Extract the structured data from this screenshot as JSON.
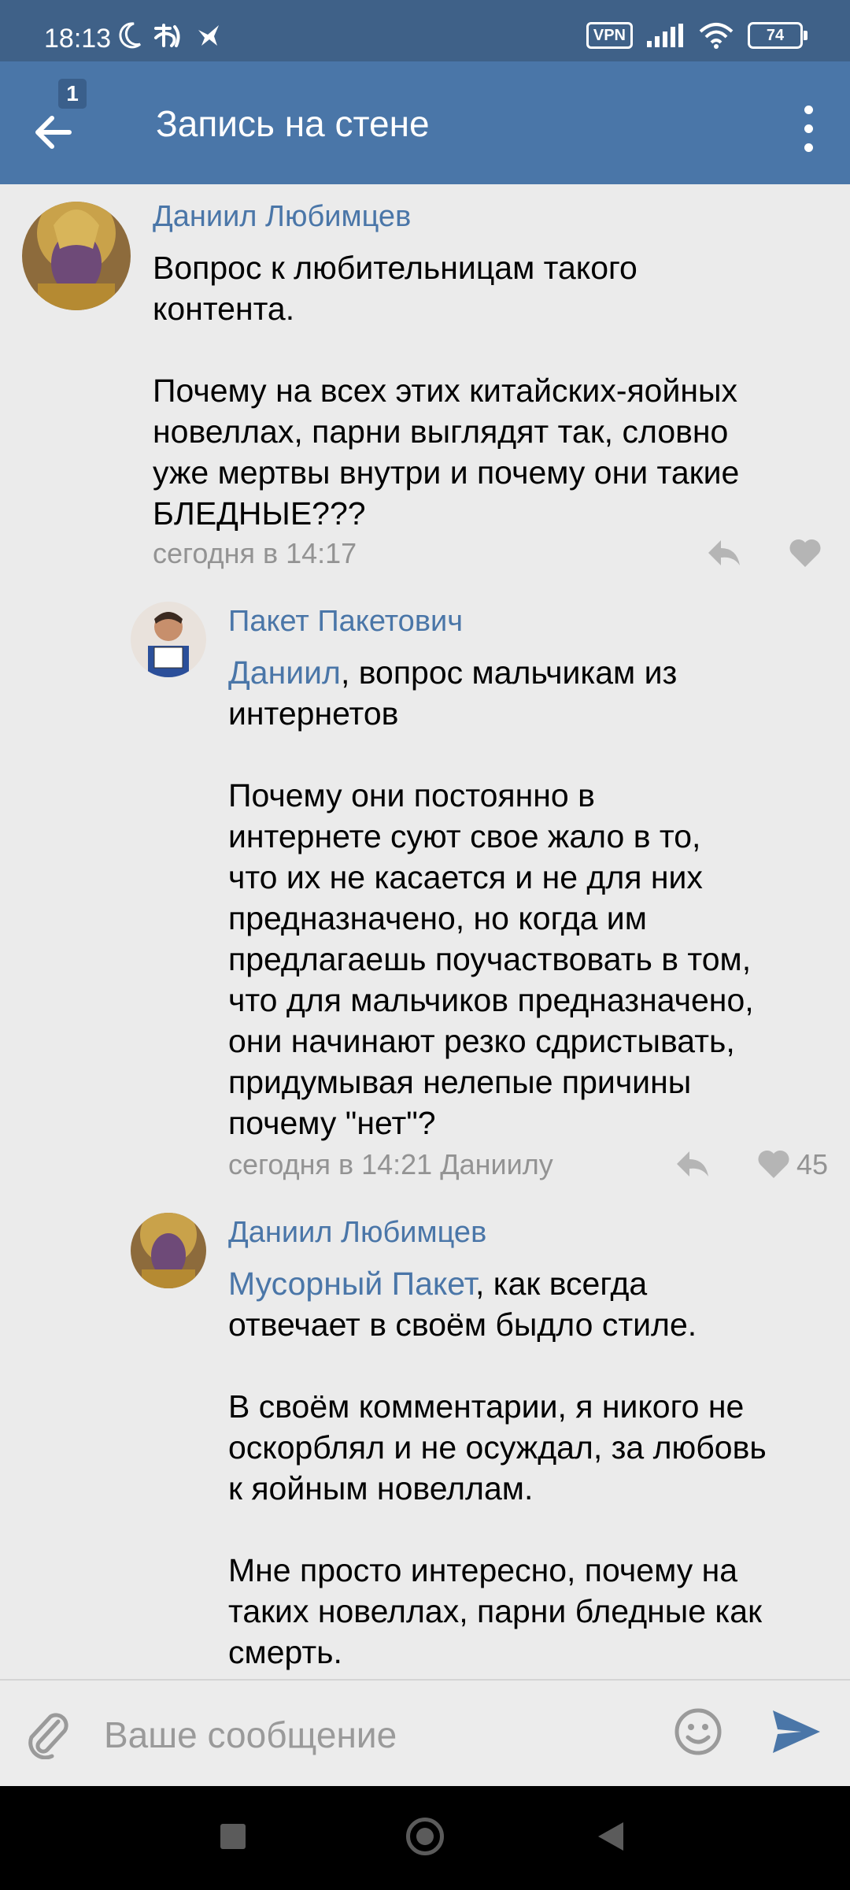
{
  "status_bar": {
    "time": "18:13",
    "vpn_label": "VPN",
    "battery": "74"
  },
  "header": {
    "back_badge": "1",
    "title": "Запись на стене"
  },
  "comments": [
    {
      "author": "Даниил Любимцев",
      "text": "Вопрос к любительницам такого\nконтента.\n\nПочему на всех этих китайских-яойных\nновеллах, парни выглядят так, словно\nуже мертвы внутри и почему они такие\nБЛЕДНЫЕ???",
      "meta": "сегодня в 14:17"
    },
    {
      "author": "Пакет Пакетович",
      "mention": "Даниил",
      "text": ", вопрос мальчикам из\nинтернетов\n\nПочему они постоянно в\nинтернете суют свое жало в то,\nчто их не касается и не для них\nпредназначено, но когда им\nпредлагаешь поучаствовать в том,\nчто для мальчиков предназначено,\nони начинают резко сдристывать,\nпридумывая нелепые причины\nпочему \"нет\"?",
      "meta": "сегодня в 14:21 Даниилу",
      "likes": "45"
    },
    {
      "author": "Даниил Любимцев",
      "mention": "Мусорный Пакет",
      "text": ", как всегда\nотвечает в своём быдло стиле.\n\nВ своём комментарии, я никого не\nоскорблял и не осуждал, за любовь\nк яойным новеллам.\n\nМне просто интересно, почему на\nтаких новеллах, парни бледные как\nсмерть."
    }
  ],
  "composer": {
    "placeholder": "Ваше сообщение"
  },
  "colors": {
    "header": "#4a76a8",
    "status_bar": "#3f6188",
    "link": "#4a76a8",
    "meta": "#939393",
    "background": "#ebebeb"
  },
  "icons": [
    "back-arrow-icon",
    "more-vert-icon",
    "reply-icon",
    "heart-icon",
    "paperclip-icon",
    "emoji-icon",
    "send-icon"
  ]
}
